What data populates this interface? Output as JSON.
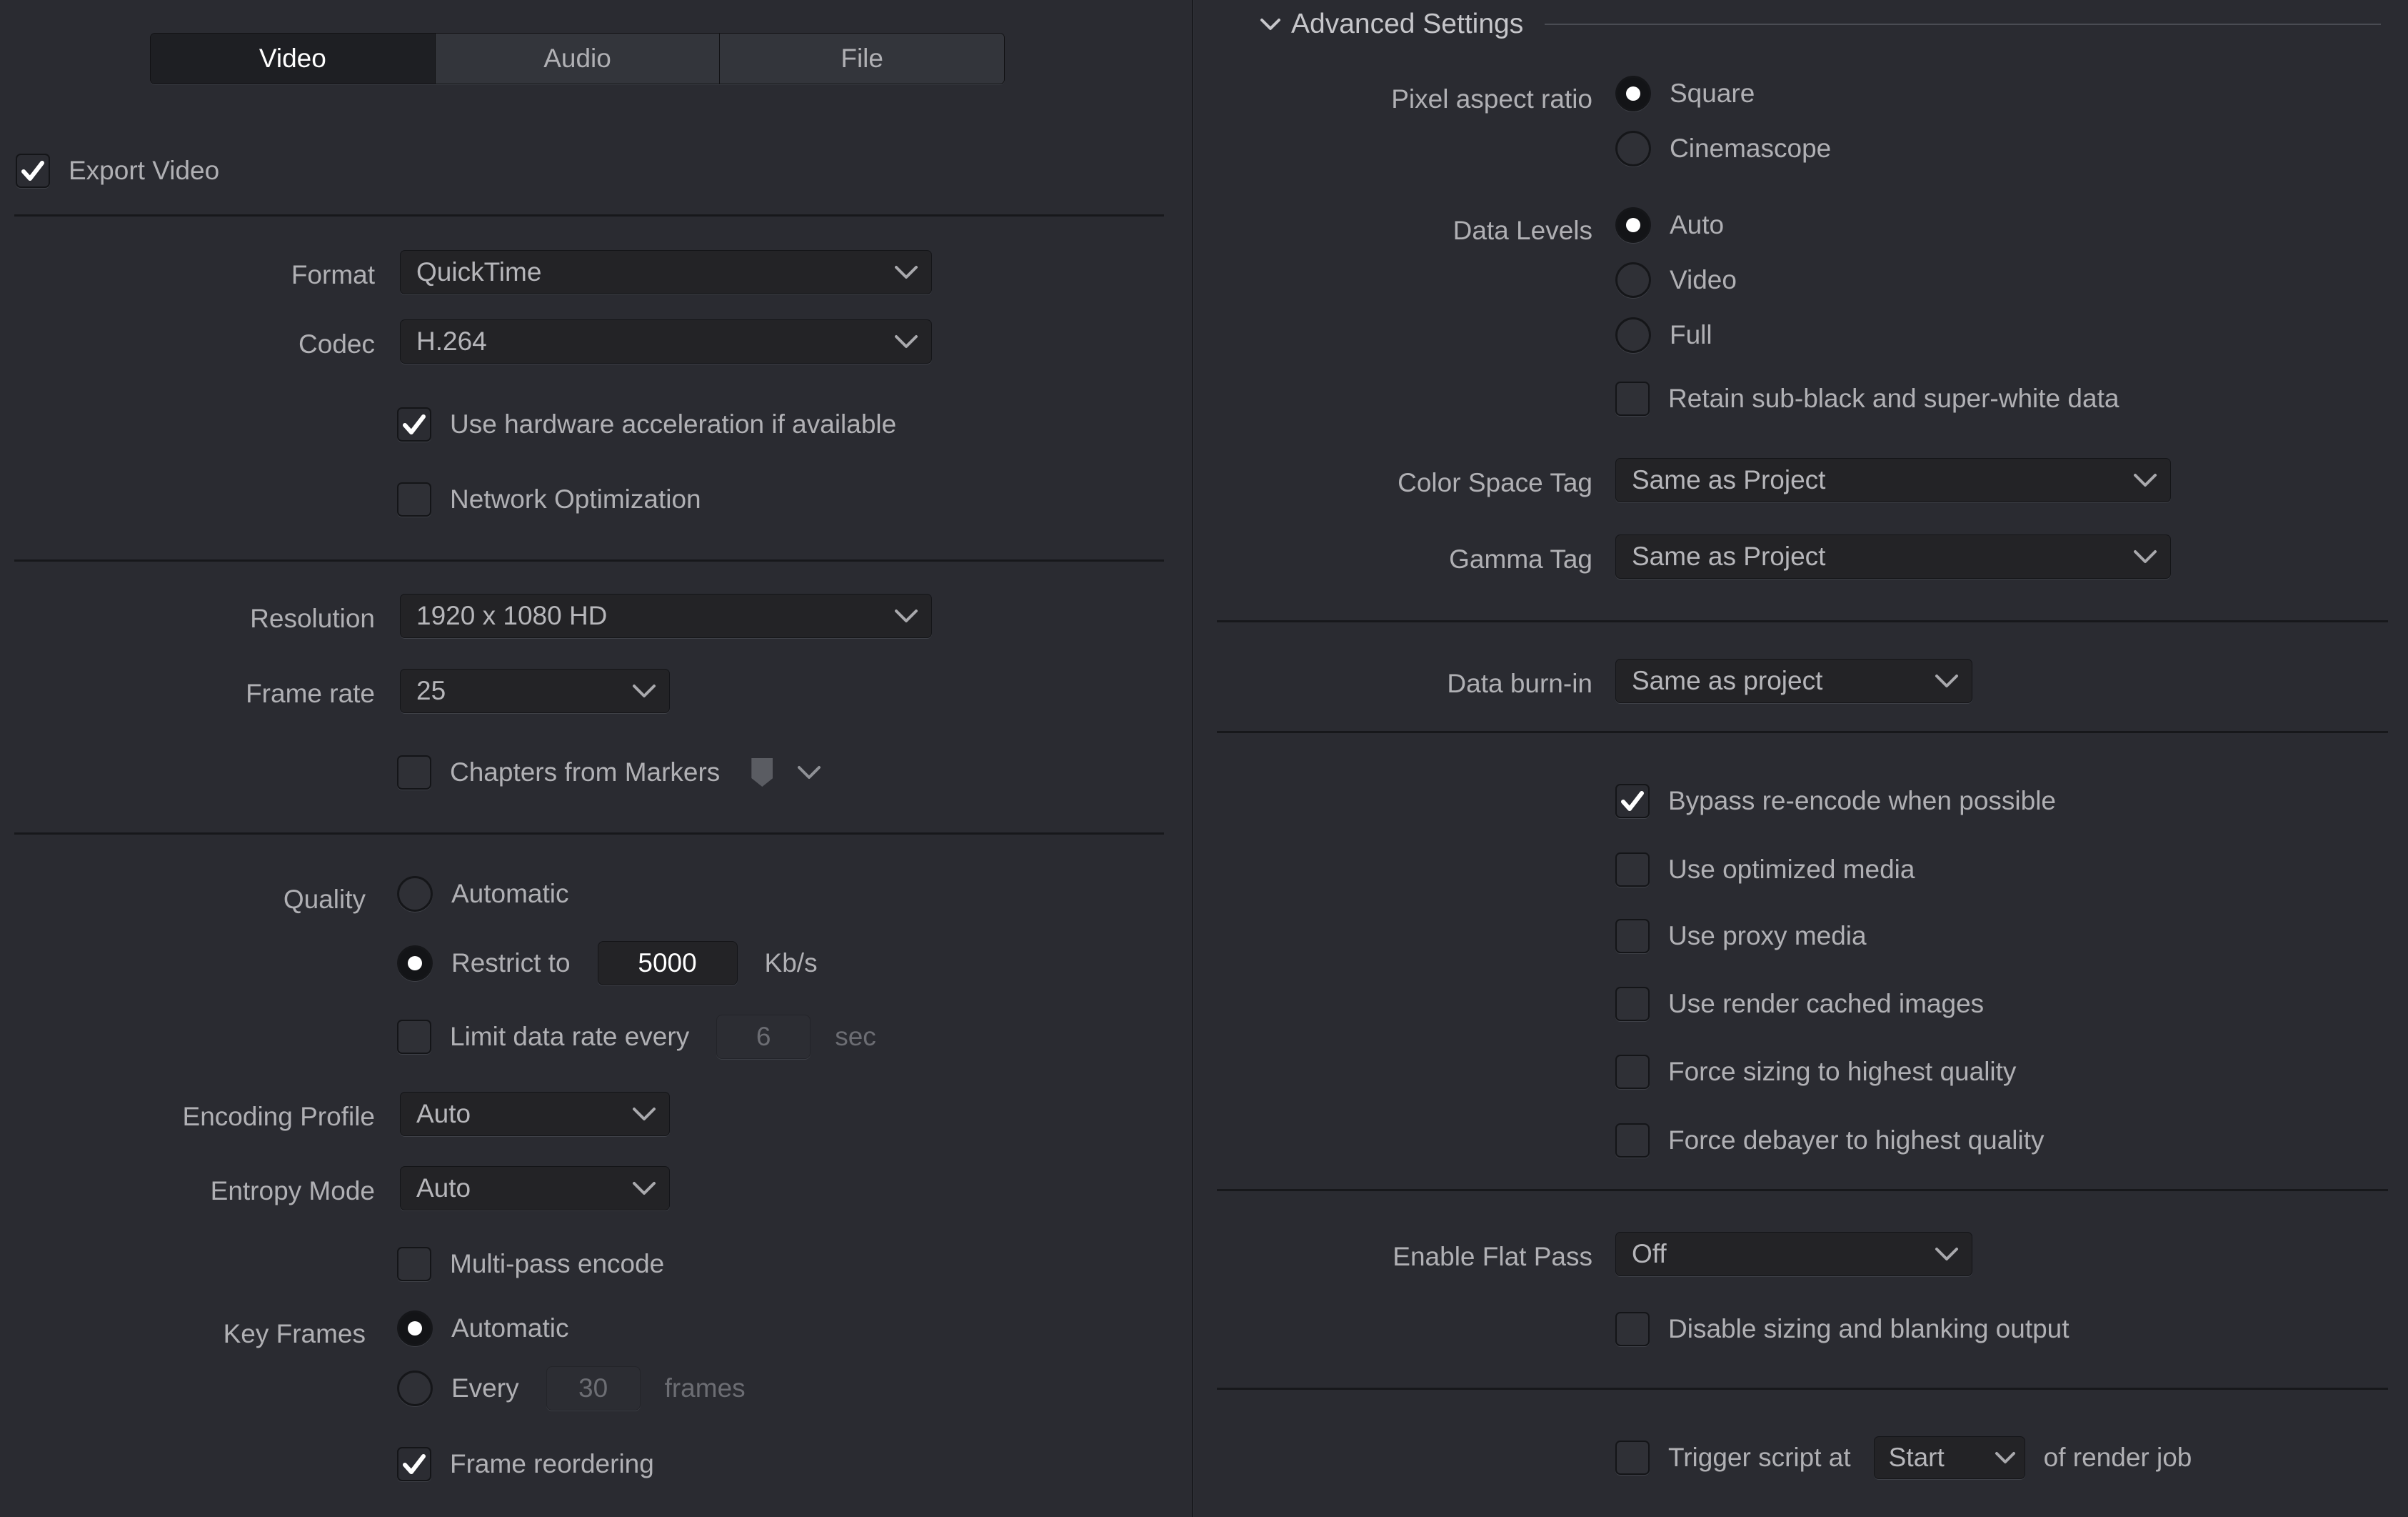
{
  "tabs": [
    {
      "label": "Video",
      "active": true
    },
    {
      "label": "Audio",
      "active": false
    },
    {
      "label": "File",
      "active": false
    }
  ],
  "left": {
    "export_video": {
      "label": "Export Video",
      "checked": true
    },
    "format": {
      "label": "Format",
      "value": "QuickTime"
    },
    "codec": {
      "label": "Codec",
      "value": "H.264"
    },
    "hw_accel": {
      "label": "Use hardware acceleration if available",
      "checked": true
    },
    "network_opt": {
      "label": "Network Optimization",
      "checked": false
    },
    "resolution": {
      "label": "Resolution",
      "value": "1920 x 1080 HD"
    },
    "frame_rate": {
      "label": "Frame rate",
      "value": "25"
    },
    "chapters": {
      "label": "Chapters from Markers",
      "checked": false,
      "marker_icon": "marker-flag-icon"
    },
    "quality": {
      "label": "Quality",
      "automatic": {
        "label": "Automatic",
        "selected": false
      },
      "restrict": {
        "label": "Restrict to",
        "selected": true,
        "value": "5000",
        "unit": "Kb/s"
      },
      "limit_rate": {
        "label": "Limit data rate every",
        "checked": false,
        "value": "6",
        "unit": "sec"
      }
    },
    "encoding_profile": {
      "label": "Encoding Profile",
      "value": "Auto"
    },
    "entropy_mode": {
      "label": "Entropy Mode",
      "value": "Auto"
    },
    "multipass": {
      "label": "Multi-pass encode",
      "checked": false
    },
    "key_frames": {
      "label": "Key Frames",
      "automatic": {
        "label": "Automatic",
        "selected": true
      },
      "every": {
        "label": "Every",
        "selected": false,
        "value": "30",
        "unit": "frames"
      }
    },
    "frame_reordering": {
      "label": "Frame reordering",
      "checked": true
    }
  },
  "right": {
    "section_title": "Advanced Settings",
    "pixel_aspect": {
      "label": "Pixel aspect ratio",
      "options": [
        {
          "label": "Square",
          "selected": true
        },
        {
          "label": "Cinemascope",
          "selected": false
        }
      ]
    },
    "data_levels": {
      "label": "Data Levels",
      "options": [
        {
          "label": "Auto",
          "selected": true
        },
        {
          "label": "Video",
          "selected": false
        },
        {
          "label": "Full",
          "selected": false
        }
      ],
      "retain": {
        "label": "Retain sub-black and super-white data",
        "checked": false
      }
    },
    "color_space_tag": {
      "label": "Color Space Tag",
      "value": "Same as Project"
    },
    "gamma_tag": {
      "label": "Gamma Tag",
      "value": "Same as Project"
    },
    "data_burn_in": {
      "label": "Data burn-in",
      "value": "Same as project"
    },
    "options": [
      {
        "label": "Bypass re-encode when possible",
        "checked": true
      },
      {
        "label": "Use optimized media",
        "checked": false
      },
      {
        "label": "Use proxy media",
        "checked": false
      },
      {
        "label": "Use render cached images",
        "checked": false
      },
      {
        "label": "Force sizing to highest quality",
        "checked": false
      },
      {
        "label": "Force debayer to highest quality",
        "checked": false
      }
    ],
    "flat_pass": {
      "label": "Enable Flat Pass",
      "value": "Off"
    },
    "disable_sizing": {
      "label": "Disable sizing and blanking output",
      "checked": false
    },
    "trigger_script": {
      "checked": false,
      "prefix": "Trigger script at",
      "value": "Start",
      "suffix": "of render job"
    }
  },
  "colors": {
    "background": "#2a2b31",
    "control_bg": "#232326",
    "text": "#b0b0b4",
    "text_bright": "#ffffff",
    "separator": "#17181b"
  }
}
